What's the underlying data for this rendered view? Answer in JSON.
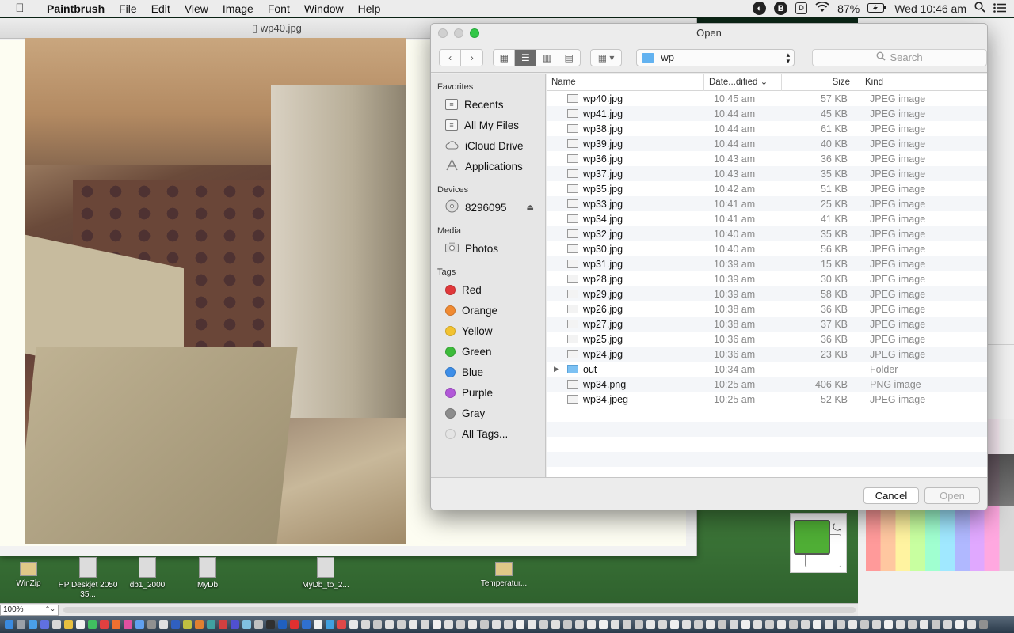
{
  "menubar": {
    "app": "Paintbrush",
    "items": [
      "File",
      "Edit",
      "View",
      "Image",
      "Font",
      "Window",
      "Help"
    ],
    "battery": "87%",
    "clock": "Wed 10:46 am"
  },
  "document": {
    "title": "wp40.jpg"
  },
  "dialog": {
    "title": "Open",
    "location": "wp",
    "search_placeholder": "Search",
    "sidebar": {
      "favorites_label": "Favorites",
      "favorites": [
        "Recents",
        "All My Files",
        "iCloud Drive",
        "Applications"
      ],
      "devices_label": "Devices",
      "devices": [
        "8296095"
      ],
      "media_label": "Media",
      "media": [
        "Photos"
      ],
      "tags_label": "Tags",
      "tags": [
        {
          "name": "Red",
          "color": "#e0383a"
        },
        {
          "name": "Orange",
          "color": "#f08a32"
        },
        {
          "name": "Yellow",
          "color": "#f2c230"
        },
        {
          "name": "Green",
          "color": "#3dbb3a"
        },
        {
          "name": "Blue",
          "color": "#3d8ee8"
        },
        {
          "name": "Purple",
          "color": "#b158d8"
        },
        {
          "name": "Gray",
          "color": "#8c8c8c"
        },
        {
          "name": "All Tags...",
          "color": "#e4e4e4"
        }
      ]
    },
    "columns": {
      "name": "Name",
      "date": "Date...dified",
      "size": "Size",
      "kind": "Kind"
    },
    "files": [
      {
        "name": "wp40.jpg",
        "date": "10:45 am",
        "size": "57 KB",
        "kind": "JPEG image"
      },
      {
        "name": "wp41.jpg",
        "date": "10:44 am",
        "size": "45 KB",
        "kind": "JPEG image"
      },
      {
        "name": "wp38.jpg",
        "date": "10:44 am",
        "size": "61 KB",
        "kind": "JPEG image"
      },
      {
        "name": "wp39.jpg",
        "date": "10:44 am",
        "size": "40 KB",
        "kind": "JPEG image"
      },
      {
        "name": "wp36.jpg",
        "date": "10:43 am",
        "size": "36 KB",
        "kind": "JPEG image"
      },
      {
        "name": "wp37.jpg",
        "date": "10:43 am",
        "size": "35 KB",
        "kind": "JPEG image"
      },
      {
        "name": "wp35.jpg",
        "date": "10:42 am",
        "size": "51 KB",
        "kind": "JPEG image"
      },
      {
        "name": "wp33.jpg",
        "date": "10:41 am",
        "size": "25 KB",
        "kind": "JPEG image"
      },
      {
        "name": "wp34.jpg",
        "date": "10:41 am",
        "size": "41 KB",
        "kind": "JPEG image"
      },
      {
        "name": "wp32.jpg",
        "date": "10:40 am",
        "size": "35 KB",
        "kind": "JPEG image"
      },
      {
        "name": "wp30.jpg",
        "date": "10:40 am",
        "size": "56 KB",
        "kind": "JPEG image"
      },
      {
        "name": "wp31.jpg",
        "date": "10:39 am",
        "size": "15 KB",
        "kind": "JPEG image"
      },
      {
        "name": "wp28.jpg",
        "date": "10:39 am",
        "size": "30 KB",
        "kind": "JPEG image"
      },
      {
        "name": "wp29.jpg",
        "date": "10:39 am",
        "size": "58 KB",
        "kind": "JPEG image"
      },
      {
        "name": "wp26.jpg",
        "date": "10:38 am",
        "size": "36 KB",
        "kind": "JPEG image"
      },
      {
        "name": "wp27.jpg",
        "date": "10:38 am",
        "size": "37 KB",
        "kind": "JPEG image"
      },
      {
        "name": "wp25.jpg",
        "date": "10:36 am",
        "size": "36 KB",
        "kind": "JPEG image"
      },
      {
        "name": "wp24.jpg",
        "date": "10:36 am",
        "size": "23 KB",
        "kind": "JPEG image"
      },
      {
        "name": "out",
        "date": "10:34 am",
        "size": "--",
        "kind": "Folder",
        "folder": true
      },
      {
        "name": "wp34.png",
        "date": "10:25 am",
        "size": "406 KB",
        "kind": "PNG image"
      },
      {
        "name": "wp34.jpeg",
        "date": "10:25 am",
        "size": "52 KB",
        "kind": "JPEG image"
      }
    ],
    "cancel_label": "Cancel",
    "open_label": "Open"
  },
  "desktop_icons": [
    {
      "label": "WinZip"
    },
    {
      "label": "HP Deskjet 2050 35..."
    },
    {
      "label": "db1_2000"
    },
    {
      "label": "MyDb"
    },
    {
      "label": "MyDb_to_2..."
    },
    {
      "label": "Temperatur..."
    }
  ],
  "statusbar": {
    "zoom": "100%"
  },
  "colors": {
    "foreground": "#4fae35",
    "background": "#ffffff"
  }
}
